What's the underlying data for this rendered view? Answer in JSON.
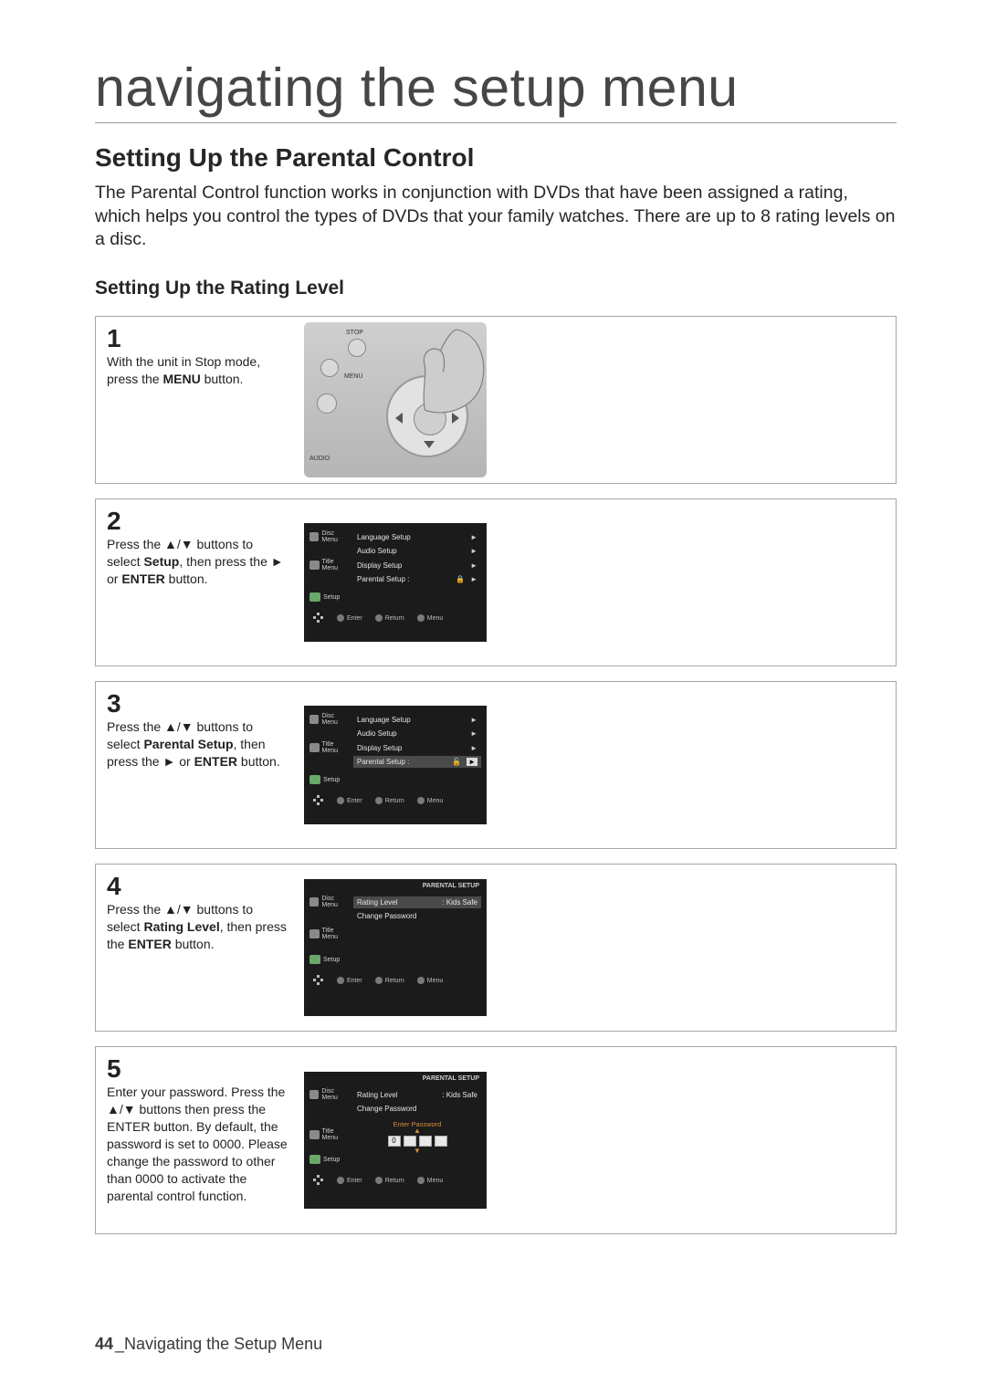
{
  "chapter": "navigating the setup menu",
  "section_title": "Setting Up the Parental Control",
  "intro": "The Parental Control function works in conjunction with DVDs that have been assigned a rating, which helps you control the types of DVDs that your family watches. There are up to 8 rating levels on a disc.",
  "subheading": "Setting Up the Rating Level",
  "steps": {
    "s1": {
      "num": "1",
      "text_a": "With the unit in Stop mode, press the ",
      "bold_a": "MENU",
      "text_b": " button."
    },
    "s2": {
      "num": "2",
      "text_a": "Press the ▲/▼ buttons to select ",
      "bold_a": "Setup",
      "text_b": ", then press the ► or ",
      "bold_b": "ENTER",
      "text_c": " button."
    },
    "s3": {
      "num": "3",
      "text_a": "Press the ▲/▼ buttons to select ",
      "bold_a": "Parental Setup",
      "text_b": ", then press the ► or ",
      "bold_b": "ENTER",
      "text_c": " button."
    },
    "s4": {
      "num": "4",
      "text_a": "Press the ▲/▼ buttons to select ",
      "bold_a": "Rating Level",
      "text_b": ", then press the ",
      "bold_b": "ENTER",
      "text_c": " button."
    },
    "s5": {
      "num": "5",
      "text_a": "Enter your password. Press the ▲/▼ buttons then press the ENTER button. By default, the password is set to 0000. Please change the password to other than 0000 to activate the parental control function."
    }
  },
  "remote_labels": {
    "stop": "STOP",
    "menu": "MENU",
    "audio": "AUDIO"
  },
  "osd_common": {
    "tabs": {
      "disc": "Disc Menu",
      "title": "Title Menu",
      "setup": "Setup"
    },
    "footer": {
      "enter": "Enter",
      "return": "Return",
      "menu": "Menu"
    }
  },
  "osd2": {
    "items": [
      "Language Setup",
      "Audio Setup",
      "Display Setup",
      "Parental Setup :"
    ],
    "lock": "🔒"
  },
  "osd3": {
    "items": [
      "Language Setup",
      "Audio Setup",
      "Display Setup",
      "Parental Setup :"
    ],
    "lock": "🔓"
  },
  "osd4": {
    "breadcrumb": "PARENTAL SETUP",
    "rating_label": "Rating Level",
    "rating_value": ": Kids Safe",
    "change_pw": "Change Password"
  },
  "osd5": {
    "breadcrumb": "PARENTAL SETUP",
    "rating_label": "Rating Level",
    "rating_value": ": Kids Safe",
    "change_pw": "Change Password",
    "enter_pw": "Enter Password",
    "digit": "0"
  },
  "footer": {
    "page": "44",
    "sep": "_",
    "label": "Navigating the Setup Menu"
  }
}
